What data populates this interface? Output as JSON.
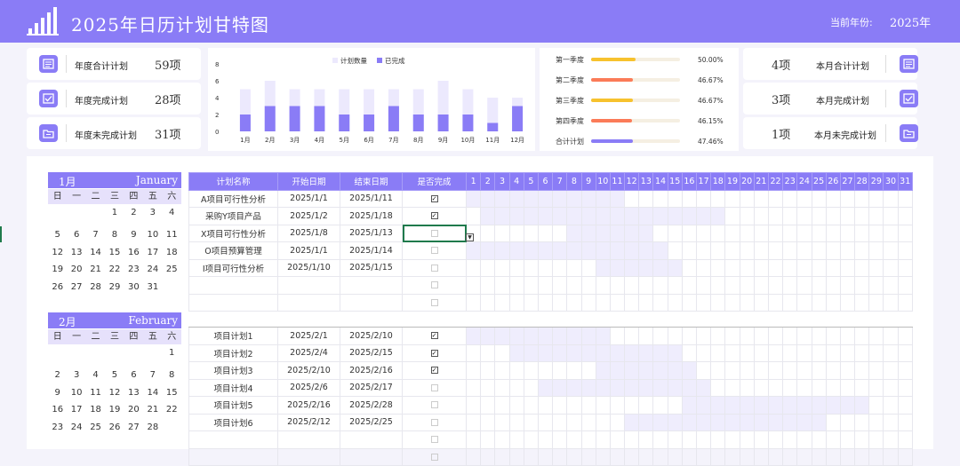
{
  "header": {
    "title": "2025年日历计划甘特图",
    "year_label": "当前年份:",
    "year_value": "2025年"
  },
  "stats_left": [
    {
      "label": "年度合计计划",
      "value": "59项",
      "icon": "list-icon"
    },
    {
      "label": "年度完成计划",
      "value": "28项",
      "icon": "done-icon"
    },
    {
      "label": "年度未完成计划",
      "value": "31项",
      "icon": "folder-icon"
    }
  ],
  "stats_right": [
    {
      "label": "本月合计计划",
      "value": "4项",
      "icon": "list-icon"
    },
    {
      "label": "本月完成计划",
      "value": "3项",
      "icon": "done-icon"
    },
    {
      "label": "本月未完成计划",
      "value": "1项",
      "icon": "folder-icon"
    }
  ],
  "chart_data": {
    "type": "bar",
    "categories": [
      "1月",
      "2月",
      "3月",
      "4月",
      "5月",
      "6月",
      "7月",
      "8月",
      "9月",
      "10月",
      "11月",
      "12月"
    ],
    "series": [
      {
        "name": "计划数量",
        "values": [
          5,
          6,
          5,
          5,
          5,
          5,
          5,
          5,
          6,
          5,
          4,
          4
        ],
        "color": "#ece9fd"
      },
      {
        "name": "已完成",
        "values": [
          2,
          3,
          3,
          3,
          2,
          2,
          3,
          2,
          2,
          2,
          1,
          3
        ],
        "color": "#8a7cf6"
      }
    ],
    "yticks": [
      0,
      2,
      4,
      6,
      8
    ],
    "ylim": [
      0,
      8
    ],
    "legend": "top"
  },
  "quarters": [
    {
      "label": "第一季度",
      "pct": "50.00%",
      "value": 0.5,
      "color": "#f7c22e"
    },
    {
      "label": "第二季度",
      "pct": "46.67%",
      "value": 0.4667,
      "color": "#fb7b58"
    },
    {
      "label": "第三季度",
      "pct": "46.67%",
      "value": 0.4667,
      "color": "#f7c22e"
    },
    {
      "label": "第四季度",
      "pct": "46.15%",
      "value": 0.4615,
      "color": "#fb7b58"
    },
    {
      "label": "合计计划",
      "pct": "47.46%",
      "value": 0.4746,
      "color": "#8a7cf6"
    }
  ],
  "calendars": [
    {
      "month": "1月",
      "en": "January",
      "weeks": [
        [
          "",
          "",
          "",
          "1",
          "2",
          "3",
          "4"
        ],
        [
          "5",
          "6",
          "7",
          "8",
          "9",
          "10",
          "11"
        ],
        [
          "12",
          "13",
          "14",
          "15",
          "16",
          "17",
          "18"
        ],
        [
          "19",
          "20",
          "21",
          "22",
          "23",
          "24",
          "25"
        ],
        [
          "26",
          "27",
          "28",
          "29",
          "30",
          "31",
          ""
        ]
      ]
    },
    {
      "month": "2月",
      "en": "February",
      "weeks": [
        [
          "",
          "",
          "",
          "",
          "",
          "",
          "1"
        ],
        [
          "2",
          "3",
          "4",
          "5",
          "6",
          "7",
          "8"
        ],
        [
          "9",
          "10",
          "11",
          "12",
          "13",
          "14",
          "15"
        ],
        [
          "16",
          "17",
          "18",
          "19",
          "20",
          "21",
          "22"
        ],
        [
          "23",
          "24",
          "25",
          "26",
          "27",
          "28",
          ""
        ]
      ]
    }
  ],
  "weekdays": [
    "日",
    "一",
    "二",
    "三",
    "四",
    "五",
    "六"
  ],
  "gantt": {
    "headers": [
      "计划名称",
      "开始日期",
      "结束日期",
      "是否完成"
    ],
    "days": [
      "1",
      "2",
      "3",
      "4",
      "5",
      "6",
      "7",
      "8",
      "9",
      "10",
      "11",
      "12",
      "13",
      "14",
      "15",
      "16",
      "17",
      "18",
      "19",
      "20",
      "21",
      "22",
      "23",
      "24",
      "25",
      "26",
      "27",
      "28",
      "29",
      "30",
      "31"
    ],
    "rows": [
      {
        "name": "A项目可行性分析",
        "start": "2025/1/1",
        "end": "2025/1/11",
        "done": true,
        "s": 1,
        "e": 11
      },
      {
        "name": "采购Y项目产品",
        "start": "2025/1/2",
        "end": "2025/1/18",
        "done": true,
        "s": 2,
        "e": 18
      },
      {
        "name": "X项目可行性分析",
        "start": "2025/1/8",
        "end": "2025/1/13",
        "done": false,
        "s": 8,
        "e": 13,
        "selected": true
      },
      {
        "name": "O项目预算管理",
        "start": "2025/1/1",
        "end": "2025/1/14",
        "done": false,
        "s": 1,
        "e": 14
      },
      {
        "name": "I项目可行性分析",
        "start": "2025/1/10",
        "end": "2025/1/15",
        "done": false,
        "s": 10,
        "e": 15
      },
      {
        "name": "",
        "start": "",
        "end": "",
        "done": false,
        "s": 0,
        "e": 0
      },
      {
        "name": "",
        "start": "",
        "end": "",
        "done": false,
        "s": 0,
        "e": 0
      },
      {
        "sp": true
      },
      {
        "name": "项目计划1",
        "start": "2025/2/1",
        "end": "2025/2/10",
        "done": true,
        "s": 1,
        "e": 10
      },
      {
        "name": "项目计划2",
        "start": "2025/2/4",
        "end": "2025/2/15",
        "done": true,
        "s": 4,
        "e": 15
      },
      {
        "name": "项目计划3",
        "start": "2025/2/10",
        "end": "2025/2/16",
        "done": true,
        "s": 10,
        "e": 16
      },
      {
        "name": "项目计划4",
        "start": "2025/2/6",
        "end": "2025/2/17",
        "done": false,
        "s": 6,
        "e": 17
      },
      {
        "name": "项目计划5",
        "start": "2025/2/16",
        "end": "2025/2/28",
        "done": false,
        "s": 16,
        "e": 28
      },
      {
        "name": "项目计划6",
        "start": "2025/2/12",
        "end": "2025/2/25",
        "done": false,
        "s": 12,
        "e": 25
      },
      {
        "name": "",
        "start": "",
        "end": "",
        "done": false,
        "s": 0,
        "e": 0
      },
      {
        "name": "",
        "start": "",
        "end": "",
        "done": false,
        "s": 0,
        "e": 0
      }
    ]
  }
}
